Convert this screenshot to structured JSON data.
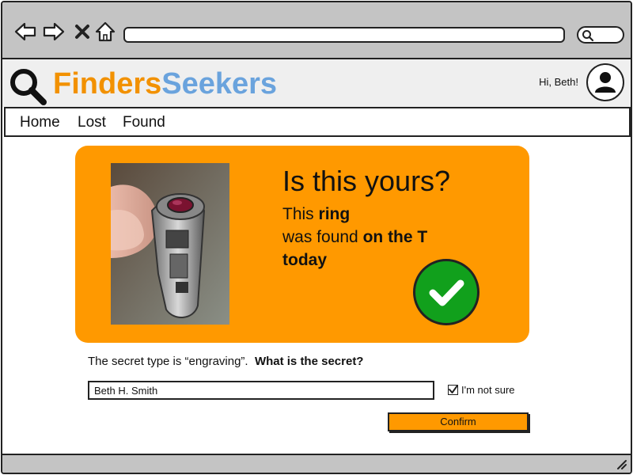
{
  "browser": {
    "back_icon": "arrow-left-icon",
    "forward_icon": "arrow-right-icon",
    "stop_icon": "close-icon",
    "home_icon": "home-icon",
    "address": "",
    "search_icon": "search-icon"
  },
  "header": {
    "logo_part1": "Finders",
    "logo_part2": "Seekers",
    "logo_colors": {
      "finders": "#f29100",
      "seekers": "#6aa3dd"
    },
    "greeting": "Hi, Beth!",
    "avatar_icon": "user-icon"
  },
  "menu": {
    "items": [
      {
        "label": "Home"
      },
      {
        "label": "Lost"
      },
      {
        "label": "Found"
      }
    ]
  },
  "card": {
    "background": "#ff9900",
    "title": "Is this yours?",
    "line1_prefix": "This ",
    "line1_bold": "ring",
    "line2_prefix": "was found ",
    "line2_bold": "on the T",
    "line3_bold": "today",
    "confirm_icon": "check-icon",
    "confirm_color": "#11a01c"
  },
  "question": {
    "prefix": "The secret type is “engraving”.",
    "bold": "What is the secret?"
  },
  "secret_input": {
    "value": "Beth H. Smith",
    "placeholder": ""
  },
  "unsure": {
    "label": "I'm not sure",
    "checked": true
  },
  "confirm_button": {
    "label": "Confirm"
  }
}
